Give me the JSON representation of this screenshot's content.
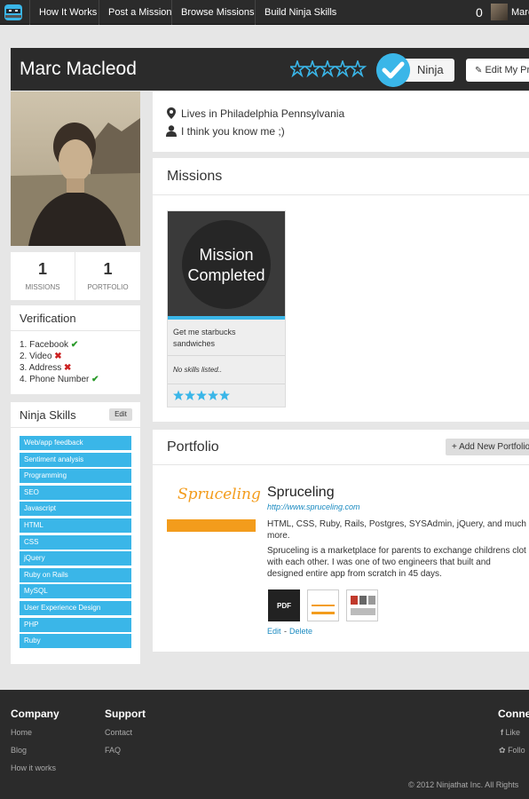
{
  "nav": {
    "items": [
      "How It Works",
      "Post a Mission",
      "Browse Missions",
      "Build Ninja Skills"
    ],
    "count": "0",
    "user": "Marc"
  },
  "profile": {
    "name": "Marc Macleod",
    "rating": 0,
    "badge_label": "Ninja",
    "edit_label": "Edit My Pr",
    "location": "Lives in Philadelphia Pennsylvania",
    "tagline": "I think you know me ;)"
  },
  "stats": {
    "missions_count": "1",
    "missions_label": "MISSIONS",
    "portfolio_count": "1",
    "portfolio_label": "PORTFOLIO"
  },
  "verification": {
    "title": "Verification",
    "items": [
      {
        "label": "1. Facebook",
        "status": "ok"
      },
      {
        "label": "2. Video",
        "status": "bad"
      },
      {
        "label": "3. Address",
        "status": "bad"
      },
      {
        "label": "4. Phone Number",
        "status": "ok"
      }
    ]
  },
  "skills": {
    "title": "Ninja Skills",
    "edit_label": "Edit",
    "items": [
      "Web/app feedback",
      "Sentiment analysis",
      "Programming",
      "SEO",
      "Javascript",
      "HTML",
      "CSS",
      "jQuery",
      "Ruby on Rails",
      "MySQL",
      "User Experience Design",
      "PHP",
      "Ruby"
    ]
  },
  "missions": {
    "title": "Missions",
    "overlay_text_1": "Mission",
    "overlay_text_2": "Completed",
    "card_title": "Get me starbucks sandwiches",
    "card_skills": "No skills listed..",
    "card_rating": 5
  },
  "portfolio": {
    "title": "Portfolio",
    "add_label": "Add New Portfolio",
    "logo_text": "Spruceling",
    "item_title": "Spruceling",
    "item_url": "http://www.spruceling.com",
    "item_tech": "HTML, CSS, Ruby, Rails, Postgres, SYSAdmin, jQuery, and much more.",
    "item_desc": "Spruceling is a marketplace for parents to exchange childrens clot with each other. I was one of two engineers that built and designed entire app from scratch in 45 days.",
    "pdf_label": "PDF",
    "edit_label": "Edit",
    "sep": "-",
    "delete_label": "Delete"
  },
  "footer": {
    "company_title": "Company",
    "company_links": [
      "Home",
      "Blog",
      "How it works"
    ],
    "support_title": "Support",
    "support_links": [
      "Contact",
      "FAQ"
    ],
    "connect_title": "Conne",
    "connect_links": [
      "Like",
      "Follo"
    ],
    "copyright": "© 2012 Ninjathat Inc. All Rights"
  },
  "colors": {
    "accent": "#3ab6e8",
    "dark": "#2b2b2b",
    "success": "#2a9a2a",
    "danger": "#cc2222",
    "orange": "#f39c1c"
  }
}
